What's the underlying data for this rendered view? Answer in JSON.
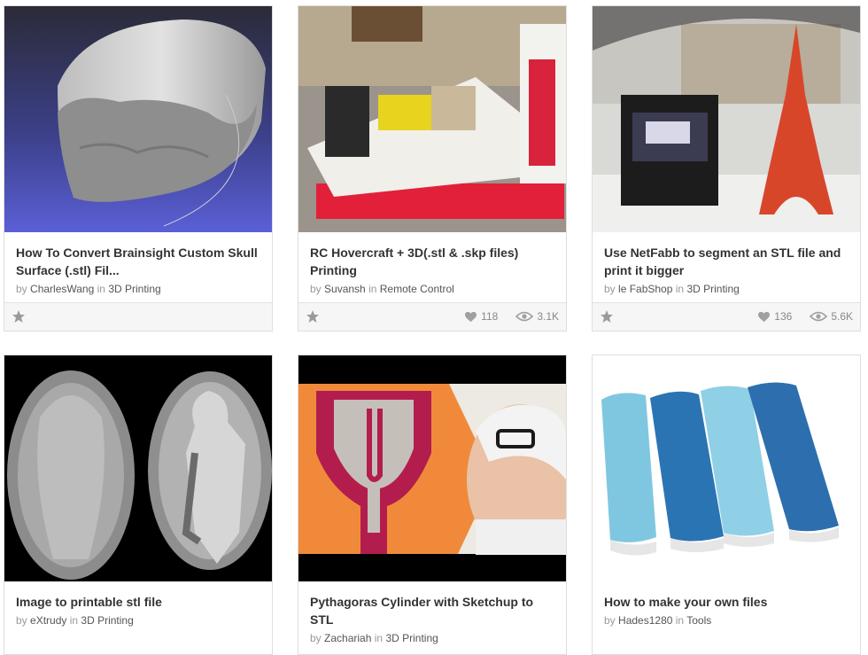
{
  "cards": [
    {
      "title": "How To Convert Brainsight Custom Skull Surface (.stl) Fil...",
      "by": "by",
      "author": "CharlesWang",
      "in": "in",
      "category": "3D Printing",
      "favorite_icon": "star-icon"
    },
    {
      "title": "RC Hovercraft + 3D(.stl & .skp files) Printing",
      "by": "by",
      "author": "Suvansh",
      "in": "in",
      "category": "Remote Control",
      "favorite_icon": "star-icon",
      "favorites": "118",
      "views": "3.1K"
    },
    {
      "title": "Use NetFabb to segment an STL file and print it bigger",
      "by": "by",
      "author": "le FabShop",
      "in": "in",
      "category": "3D Printing",
      "favorite_icon": "star-icon",
      "favorites": "136",
      "views": "5.6K"
    },
    {
      "title": "Image to printable stl file",
      "by": "by",
      "author": "eXtrudy",
      "in": "in",
      "category": "3D Printing"
    },
    {
      "title": "Pythagoras Cylinder with Sketchup to STL",
      "by": "by",
      "author": "Zachariah",
      "in": "in",
      "category": "3D Printing"
    },
    {
      "title": "How to make your own files",
      "by": "by",
      "author": "Hades1280",
      "in": "in",
      "category": "Tools"
    }
  ],
  "colors": {
    "title": "#333333",
    "byline": "#999999",
    "link": "#555555",
    "footer_bg": "#f6f6f6"
  }
}
